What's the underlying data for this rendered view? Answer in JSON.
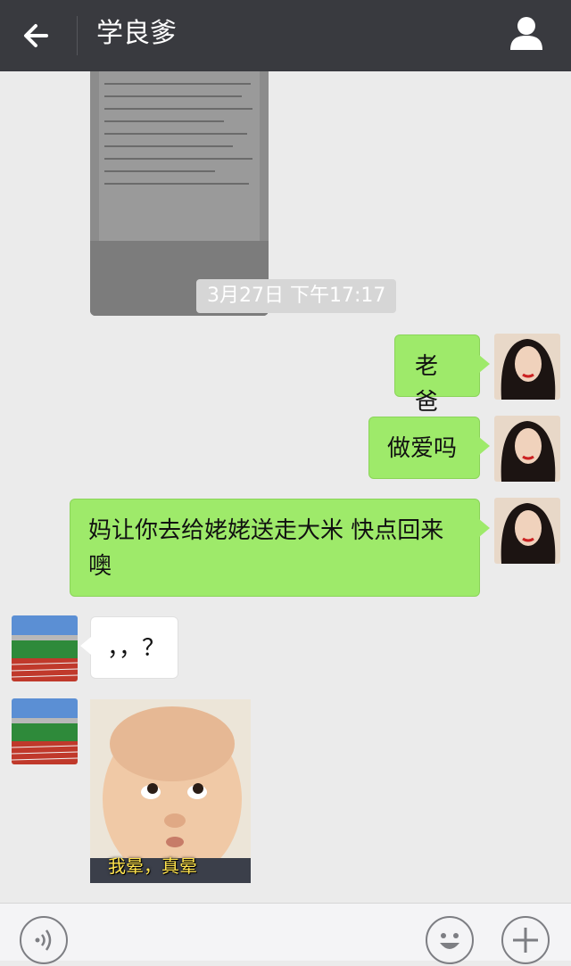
{
  "header": {
    "title": "学良爹",
    "back_icon": "arrow-left-icon",
    "profile_icon": "person-icon"
  },
  "chat": {
    "timestamp": "3月27日 下午17:17",
    "messages": [
      {
        "from": "me",
        "text": "老爸"
      },
      {
        "from": "me",
        "text": "做爱吗"
      },
      {
        "from": "me",
        "text_line1": "妈让你去给姥姥送走大米 快点回来",
        "text_line2": "噢"
      },
      {
        "from": "other",
        "text": "，，？"
      },
      {
        "from": "other",
        "type": "sticker",
        "caption": "我晕，真晕"
      }
    ]
  },
  "input_bar": {
    "voice_icon": "voice-icon",
    "emoji_icon": "smiley-icon",
    "more_icon": "plus-icon"
  },
  "colors": {
    "header_bg": "#393a3f",
    "chat_bg": "#ebebeb",
    "my_bubble": "#9eea6a",
    "other_bubble": "#ffffff"
  }
}
